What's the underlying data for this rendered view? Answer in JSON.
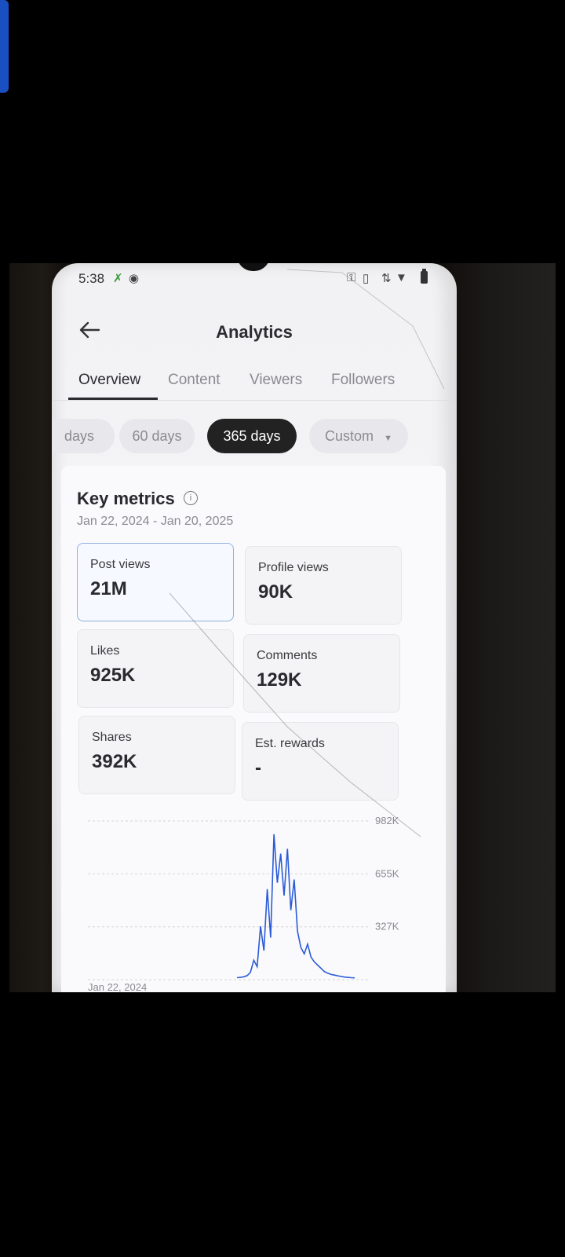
{
  "status": {
    "time": "5:38"
  },
  "header": {
    "title": "Analytics"
  },
  "tabs": [
    "Overview",
    "Content",
    "Viewers",
    "Followers"
  ],
  "date_pills": [
    "days",
    "60 days",
    "365 days",
    "Custom"
  ],
  "active_pill": "365 days",
  "key_metrics": {
    "title": "Key metrics",
    "date_range": "Jan 22, 2024 - Jan 20, 2025",
    "metrics": [
      {
        "label": "Post views",
        "value": "21M"
      },
      {
        "label": "Profile views",
        "value": "90K"
      },
      {
        "label": "Likes",
        "value": "925K"
      },
      {
        "label": "Comments",
        "value": "129K"
      },
      {
        "label": "Shares",
        "value": "392K"
      },
      {
        "label": "Est. rewards",
        "value": "-"
      }
    ]
  },
  "chart_data": {
    "type": "line",
    "y_ticks": [
      "982K",
      "655K",
      "327K"
    ],
    "x_start_label": "Jan 22, 2024",
    "ylim": [
      0,
      982000
    ],
    "series_color": "#2a5bd7",
    "values": [
      12000,
      14000,
      18000,
      25000,
      45000,
      120000,
      80000,
      330000,
      180000,
      560000,
      260000,
      900000,
      600000,
      780000,
      520000,
      810000,
      430000,
      620000,
      300000,
      200000,
      160000,
      220000,
      140000,
      110000,
      90000,
      70000,
      50000,
      40000,
      32000,
      28000,
      24000,
      20000,
      16000,
      14000,
      12000,
      11000
    ]
  }
}
